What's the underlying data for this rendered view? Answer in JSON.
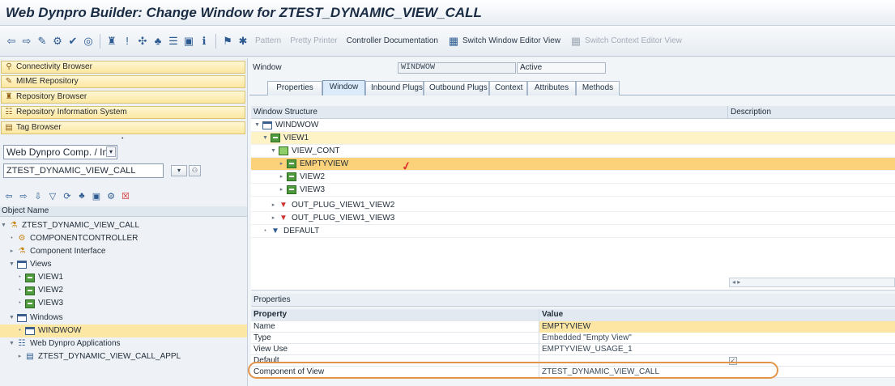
{
  "window_title": "Web Dynpro Builder: Change Window for ZTEST_DYNAMIC_VIEW_CALL",
  "toolbar": {
    "pattern": "Pattern",
    "pretty_printer": "Pretty Printer",
    "controller_documentation": "Controller Documentation",
    "switch_window_editor": "Switch Window Editor View",
    "switch_context_editor": "Switch Context Editor View"
  },
  "nav_buttons": [
    "Connectivity Browser",
    "MIME Repository",
    "Repository Browser",
    "Repository Information System",
    "Tag Browser"
  ],
  "object_type": "Web Dynpro Comp. / Intf.",
  "object_name_value": "ZTEST_DYNAMIC_VIEW_CALL",
  "object_tree_header": "Object Name",
  "object_tree": [
    {
      "label": "ZTEST_DYNAMIC_VIEW_CALL"
    },
    {
      "label": "COMPONENTCONTROLLER"
    },
    {
      "label": "Component Interface"
    },
    {
      "label": "Views"
    },
    {
      "label": "VIEW1"
    },
    {
      "label": "VIEW2"
    },
    {
      "label": "VIEW3"
    },
    {
      "label": "Windows"
    },
    {
      "label": "WINDWOW"
    },
    {
      "label": "Web Dynpro Applications"
    },
    {
      "label": "ZTEST_DYNAMIC_VIEW_CALL_APPL"
    }
  ],
  "editor": {
    "window_label": "Window",
    "window_name": "WINDWOW",
    "status": "Active",
    "tabs": [
      "Properties",
      "Window",
      "Inbound Plugs",
      "Outbound Plugs",
      "Context",
      "Attributes",
      "Methods"
    ],
    "active_tab": "Window"
  },
  "window_structure": {
    "col_structure": "Window Structure",
    "col_description": "Description",
    "rows": [
      {
        "label": "WINDWOW"
      },
      {
        "label": "VIEW1"
      },
      {
        "label": "VIEW_CONT"
      },
      {
        "label": "EMPTYVIEW"
      },
      {
        "label": "VIEW2"
      },
      {
        "label": "VIEW3"
      },
      {
        "label": "OUT_PLUG_VIEW1_VIEW2"
      },
      {
        "label": "OUT_PLUG_VIEW1_VIEW3"
      },
      {
        "label": "DEFAULT"
      }
    ]
  },
  "properties": {
    "title": "Properties",
    "col_property": "Property",
    "col_value": "Value",
    "rows": [
      {
        "property": "Name",
        "value": "EMPTYVIEW"
      },
      {
        "property": "Type",
        "value": "Embedded \"Empty View\""
      },
      {
        "property": "View Use",
        "value": "EMPTYVIEW_USAGE_1"
      },
      {
        "property": "Default",
        "value": ""
      },
      {
        "property": "Component of View",
        "value": "ZTEST_DYNAMIC_VIEW_CALL"
      }
    ]
  }
}
